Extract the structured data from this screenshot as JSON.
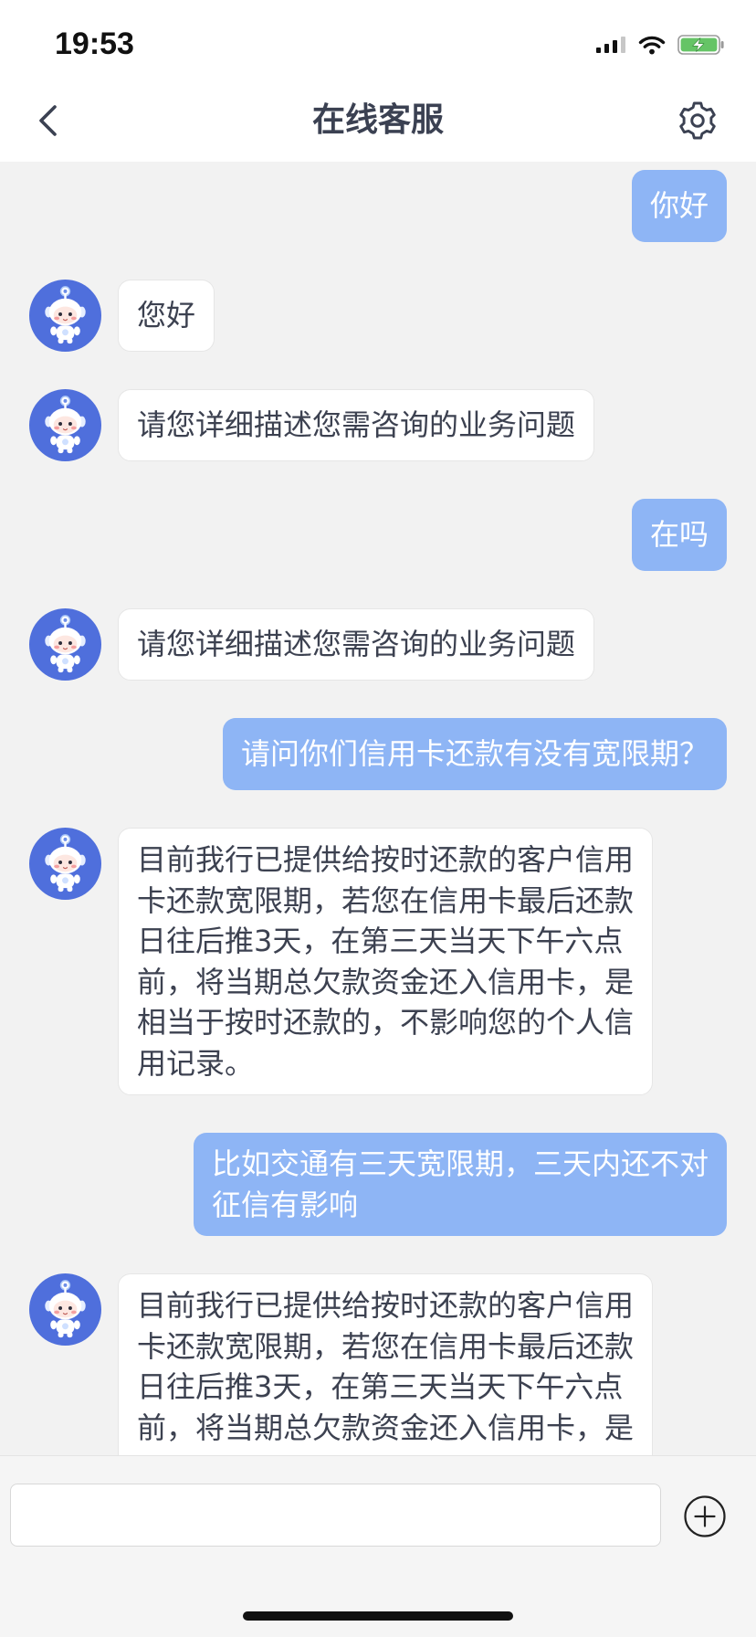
{
  "status_bar": {
    "time": "19:53",
    "signal_icon": "signal-icon",
    "wifi_icon": "wifi-icon",
    "battery_icon": "battery-charging-icon"
  },
  "header": {
    "title": "在线客服",
    "back_icon": "chevron-left-icon",
    "settings_icon": "gear-icon"
  },
  "agent_avatar_icon": "robot-avatar-icon",
  "messages": [
    {
      "outgoing": true,
      "lines": [
        "你好"
      ]
    },
    {
      "outgoing": false,
      "lines": [
        "您好"
      ]
    },
    {
      "outgoing": false,
      "lines": [
        "请您详细描述您需咨询的业务问题"
      ]
    },
    {
      "outgoing": true,
      "lines": [
        "在吗"
      ]
    },
    {
      "outgoing": false,
      "lines": [
        "请您详细描述您需咨询的业务问题"
      ]
    },
    {
      "outgoing": true,
      "lines": [
        "请问你们信用卡还款有没有宽限期？"
      ]
    },
    {
      "outgoing": false,
      "lines": [
        "目前我行已提供给按时还款的客户信用",
        "卡还款宽限期，若您在信用卡最后还款",
        "日往后推3天，在第三天当天下午六点",
        "前，将当期总欠款资金还入信用卡，是",
        "相当于按时还款的，不影响您的个人信",
        "用记录。"
      ]
    },
    {
      "outgoing": true,
      "lines": [
        "比如交通有三天宽限期，三天内还不对",
        "征信有影响"
      ]
    },
    {
      "outgoing": false,
      "lines": [
        "目前我行已提供给按时还款的客户信用",
        "卡还款宽限期，若您在信用卡最后还款",
        "日往后推3天，在第三天当天下午六点",
        "前，将当期总欠款资金还入信用卡，是"
      ]
    }
  ],
  "composer": {
    "input_value": "",
    "add_icon": "plus-circle-icon"
  },
  "colors": {
    "user_bubble": "#8eb5f5",
    "agent_bubble": "#ffffff",
    "chat_background": "#f2f2f2",
    "avatar": "#4f6fdc",
    "battery": "#65c466"
  }
}
